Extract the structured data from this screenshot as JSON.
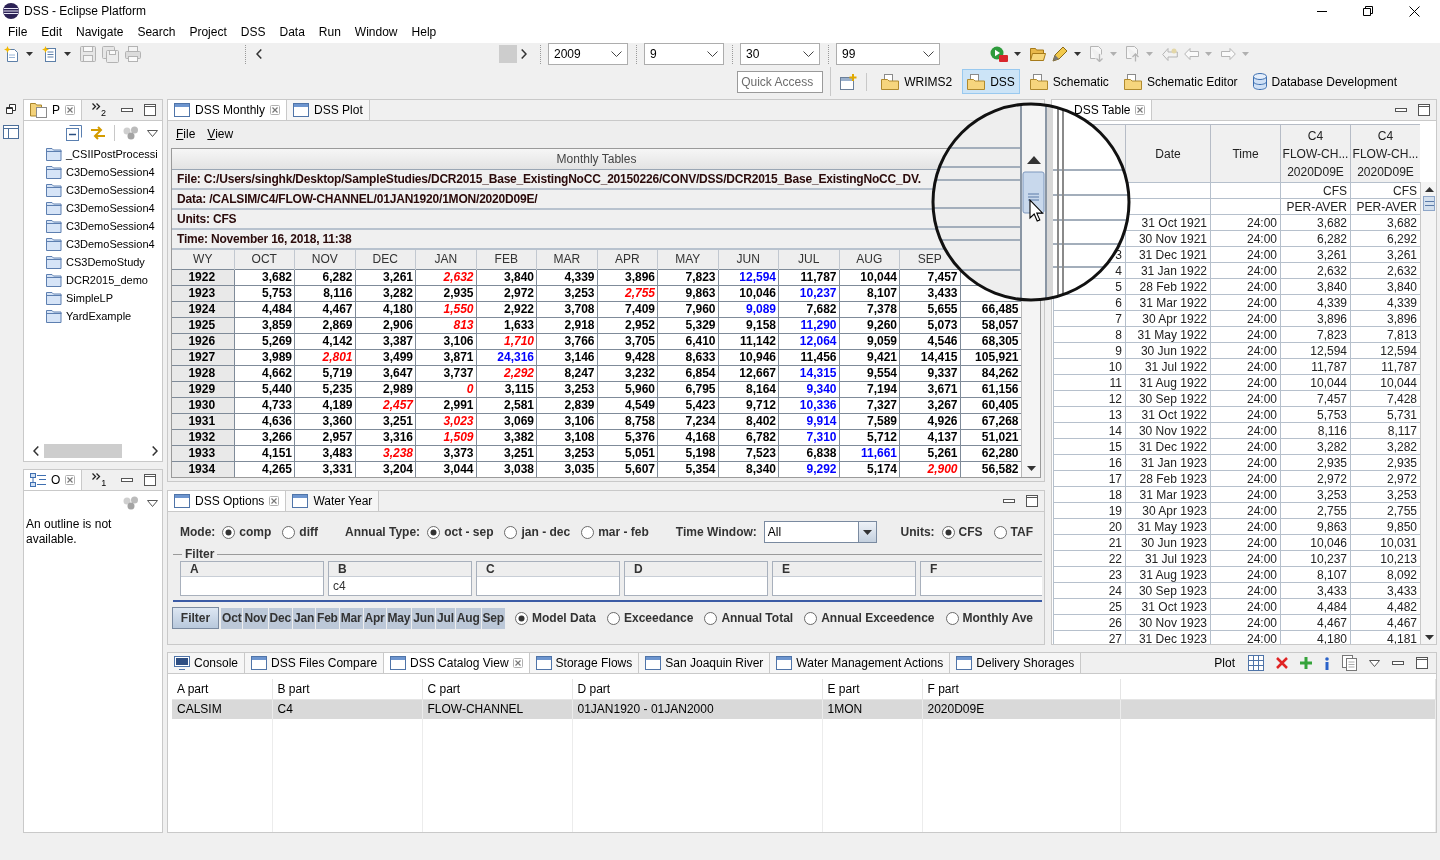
{
  "window": {
    "title": "DSS - Eclipse Platform"
  },
  "menu": [
    "File",
    "Edit",
    "Navigate",
    "Search",
    "Project",
    "DSS",
    "Data",
    "Run",
    "Window",
    "Help"
  ],
  "toolbar": {
    "combos": [
      "2009",
      "9",
      "30",
      "99"
    ]
  },
  "quick_access": {
    "placeholder": "Quick Access"
  },
  "perspectives": [
    {
      "label": "WRIMS2",
      "kind": "folder",
      "selected": false
    },
    {
      "label": "DSS",
      "kind": "folder",
      "selected": true
    },
    {
      "label": "Schematic",
      "kind": "folder",
      "selected": false
    },
    {
      "label": "Schematic Editor",
      "kind": "folder",
      "selected": false
    },
    {
      "label": "Database Development",
      "kind": "database",
      "selected": false
    }
  ],
  "project_explorer": {
    "tab": {
      "label": "P",
      "selected": true
    },
    "overflow_count": "2",
    "items": [
      "_CSIIPostProcessi",
      "C3DemoSession4",
      "C3DemoSession4",
      "C3DemoSession4",
      "C3DemoSession4",
      "C3DemoSession4",
      "CS3DemoStudy",
      "DCR2015_demo",
      "SimpleLP",
      "YardExample"
    ]
  },
  "outline": {
    "tab": {
      "label": "O",
      "selected": true
    },
    "overflow_count": "1",
    "message": "An outline is not available."
  },
  "monthly": {
    "tabs": [
      {
        "label": "DSS Monthly",
        "selected": true
      },
      {
        "label": "DSS Plot",
        "selected": false
      }
    ],
    "menu": [
      "File",
      "View"
    ],
    "title": "Monthly Tables",
    "info": [
      "File: C:/Users/singhk/Desktop/SampleStudies/DCR2015_Base_ExistingNoCC_20150226/CONV/DSS/DCR2015_Base_ExistingNoCC_DV.",
      "Data: /CALSIM/C4/FLOW-CHANNEL/01JAN1920/1MON/2020D09E/",
      "Units: CFS",
      "Time: November 16, 2018, 11:38"
    ],
    "corner": "WY",
    "columns": [
      "OCT",
      "NOV",
      "DEC",
      "JAN",
      "FEB",
      "MAR",
      "APR",
      "MAY",
      "JUN",
      "JUL",
      "AUG",
      "SEP"
    ],
    "rows": [
      {
        "wy": "1922",
        "cells": [
          {
            "value": "3,682",
            "kind": "plain"
          },
          {
            "value": "6,282",
            "kind": "plain"
          },
          {
            "value": "3,261",
            "kind": "plain"
          },
          {
            "value": "2,632",
            "kind": "low"
          },
          {
            "value": "3,840",
            "kind": "plain"
          },
          {
            "value": "4,339",
            "kind": "plain"
          },
          {
            "value": "3,896",
            "kind": "plain"
          },
          {
            "value": "7,823",
            "kind": "plain"
          },
          {
            "value": "12,594",
            "kind": "high"
          },
          {
            "value": "11,787",
            "kind": "plain"
          },
          {
            "value": "10,044",
            "kind": "plain"
          },
          {
            "value": "7,457",
            "kind": "plain"
          }
        ]
      },
      {
        "wy": "1923",
        "cells": [
          {
            "value": "5,753",
            "kind": "plain"
          },
          {
            "value": "8,116",
            "kind": "plain"
          },
          {
            "value": "3,282",
            "kind": "plain"
          },
          {
            "value": "2,935",
            "kind": "plain"
          },
          {
            "value": "2,972",
            "kind": "plain"
          },
          {
            "value": "3,253",
            "kind": "plain"
          },
          {
            "value": "2,755",
            "kind": "low"
          },
          {
            "value": "9,863",
            "kind": "plain"
          },
          {
            "value": "10,046",
            "kind": "plain"
          },
          {
            "value": "10,237",
            "kind": "high"
          },
          {
            "value": "8,107",
            "kind": "plain"
          },
          {
            "value": "3,433",
            "kind": "plain"
          }
        ]
      },
      {
        "wy": "1924",
        "cells": [
          {
            "value": "4,484",
            "kind": "plain"
          },
          {
            "value": "4,467",
            "kind": "plain"
          },
          {
            "value": "4,180",
            "kind": "plain"
          },
          {
            "value": "1,550",
            "kind": "low"
          },
          {
            "value": "2,922",
            "kind": "plain"
          },
          {
            "value": "3,708",
            "kind": "plain"
          },
          {
            "value": "7,409",
            "kind": "plain"
          },
          {
            "value": "7,960",
            "kind": "plain"
          },
          {
            "value": "9,089",
            "kind": "high"
          },
          {
            "value": "7,682",
            "kind": "plain"
          },
          {
            "value": "7,378",
            "kind": "plain"
          },
          {
            "value": "5,655",
            "kind": "plain"
          },
          {
            "value": "66,485",
            "kind": "plain"
          }
        ]
      },
      {
        "wy": "1925",
        "cells": [
          {
            "value": "3,859",
            "kind": "plain"
          },
          {
            "value": "2,869",
            "kind": "plain"
          },
          {
            "value": "2,906",
            "kind": "plain"
          },
          {
            "value": "813",
            "kind": "low"
          },
          {
            "value": "1,633",
            "kind": "plain"
          },
          {
            "value": "2,918",
            "kind": "plain"
          },
          {
            "value": "2,952",
            "kind": "plain"
          },
          {
            "value": "5,329",
            "kind": "plain"
          },
          {
            "value": "9,158",
            "kind": "plain"
          },
          {
            "value": "11,290",
            "kind": "high"
          },
          {
            "value": "9,260",
            "kind": "plain"
          },
          {
            "value": "5,073",
            "kind": "plain"
          },
          {
            "value": "58,057",
            "kind": "plain"
          }
        ]
      },
      {
        "wy": "1926",
        "cells": [
          {
            "value": "5,269",
            "kind": "plain"
          },
          {
            "value": "4,142",
            "kind": "plain"
          },
          {
            "value": "3,387",
            "kind": "plain"
          },
          {
            "value": "3,106",
            "kind": "plain"
          },
          {
            "value": "1,710",
            "kind": "low"
          },
          {
            "value": "3,766",
            "kind": "plain"
          },
          {
            "value": "3,705",
            "kind": "plain"
          },
          {
            "value": "6,410",
            "kind": "plain"
          },
          {
            "value": "11,142",
            "kind": "plain"
          },
          {
            "value": "12,064",
            "kind": "high"
          },
          {
            "value": "9,059",
            "kind": "plain"
          },
          {
            "value": "4,546",
            "kind": "plain"
          },
          {
            "value": "68,305",
            "kind": "plain"
          }
        ]
      },
      {
        "wy": "1927",
        "cells": [
          {
            "value": "3,989",
            "kind": "plain"
          },
          {
            "value": "2,801",
            "kind": "low"
          },
          {
            "value": "3,499",
            "kind": "plain"
          },
          {
            "value": "3,871",
            "kind": "plain"
          },
          {
            "value": "24,316",
            "kind": "high"
          },
          {
            "value": "3,146",
            "kind": "plain"
          },
          {
            "value": "9,428",
            "kind": "plain"
          },
          {
            "value": "8,633",
            "kind": "plain"
          },
          {
            "value": "10,946",
            "kind": "plain"
          },
          {
            "value": "11,456",
            "kind": "plain"
          },
          {
            "value": "9,421",
            "kind": "plain"
          },
          {
            "value": "14,415",
            "kind": "plain"
          },
          {
            "value": "105,921",
            "kind": "plain"
          }
        ]
      },
      {
        "wy": "1928",
        "cells": [
          {
            "value": "4,662",
            "kind": "plain"
          },
          {
            "value": "5,719",
            "kind": "plain"
          },
          {
            "value": "3,647",
            "kind": "plain"
          },
          {
            "value": "3,737",
            "kind": "plain"
          },
          {
            "value": "2,292",
            "kind": "low"
          },
          {
            "value": "8,247",
            "kind": "plain"
          },
          {
            "value": "3,232",
            "kind": "plain"
          },
          {
            "value": "6,854",
            "kind": "plain"
          },
          {
            "value": "12,667",
            "kind": "plain"
          },
          {
            "value": "14,315",
            "kind": "high"
          },
          {
            "value": "9,554",
            "kind": "plain"
          },
          {
            "value": "9,337",
            "kind": "plain"
          },
          {
            "value": "84,262",
            "kind": "plain"
          }
        ]
      },
      {
        "wy": "1929",
        "cells": [
          {
            "value": "5,440",
            "kind": "plain"
          },
          {
            "value": "5,235",
            "kind": "plain"
          },
          {
            "value": "2,989",
            "kind": "plain"
          },
          {
            "value": "0",
            "kind": "low"
          },
          {
            "value": "3,115",
            "kind": "plain"
          },
          {
            "value": "3,253",
            "kind": "plain"
          },
          {
            "value": "5,960",
            "kind": "plain"
          },
          {
            "value": "6,795",
            "kind": "plain"
          },
          {
            "value": "8,164",
            "kind": "plain"
          },
          {
            "value": "9,340",
            "kind": "high"
          },
          {
            "value": "7,194",
            "kind": "plain"
          },
          {
            "value": "3,671",
            "kind": "plain"
          },
          {
            "value": "61,156",
            "kind": "plain"
          }
        ]
      },
      {
        "wy": "1930",
        "cells": [
          {
            "value": "4,733",
            "kind": "plain"
          },
          {
            "value": "4,189",
            "kind": "plain"
          },
          {
            "value": "2,457",
            "kind": "low"
          },
          {
            "value": "2,991",
            "kind": "plain"
          },
          {
            "value": "2,581",
            "kind": "plain"
          },
          {
            "value": "2,839",
            "kind": "plain"
          },
          {
            "value": "4,549",
            "kind": "plain"
          },
          {
            "value": "5,423",
            "kind": "plain"
          },
          {
            "value": "9,712",
            "kind": "plain"
          },
          {
            "value": "10,336",
            "kind": "high"
          },
          {
            "value": "7,327",
            "kind": "plain"
          },
          {
            "value": "3,267",
            "kind": "plain"
          },
          {
            "value": "60,405",
            "kind": "plain"
          }
        ]
      },
      {
        "wy": "1931",
        "cells": [
          {
            "value": "4,636",
            "kind": "plain"
          },
          {
            "value": "3,360",
            "kind": "plain"
          },
          {
            "value": "3,251",
            "kind": "plain"
          },
          {
            "value": "3,023",
            "kind": "low"
          },
          {
            "value": "3,069",
            "kind": "plain"
          },
          {
            "value": "3,106",
            "kind": "plain"
          },
          {
            "value": "8,758",
            "kind": "plain"
          },
          {
            "value": "7,234",
            "kind": "plain"
          },
          {
            "value": "8,402",
            "kind": "plain"
          },
          {
            "value": "9,914",
            "kind": "high"
          },
          {
            "value": "7,589",
            "kind": "plain"
          },
          {
            "value": "4,926",
            "kind": "plain"
          },
          {
            "value": "67,268",
            "kind": "plain"
          }
        ]
      },
      {
        "wy": "1932",
        "cells": [
          {
            "value": "3,266",
            "kind": "plain"
          },
          {
            "value": "2,957",
            "kind": "plain"
          },
          {
            "value": "3,316",
            "kind": "plain"
          },
          {
            "value": "1,509",
            "kind": "low"
          },
          {
            "value": "3,382",
            "kind": "plain"
          },
          {
            "value": "3,108",
            "kind": "plain"
          },
          {
            "value": "5,376",
            "kind": "plain"
          },
          {
            "value": "4,168",
            "kind": "plain"
          },
          {
            "value": "6,782",
            "kind": "plain"
          },
          {
            "value": "7,310",
            "kind": "high"
          },
          {
            "value": "5,712",
            "kind": "plain"
          },
          {
            "value": "4,137",
            "kind": "plain"
          },
          {
            "value": "51,021",
            "kind": "plain"
          }
        ]
      },
      {
        "wy": "1933",
        "cells": [
          {
            "value": "4,151",
            "kind": "plain"
          },
          {
            "value": "3,483",
            "kind": "plain"
          },
          {
            "value": "3,238",
            "kind": "low"
          },
          {
            "value": "3,373",
            "kind": "plain"
          },
          {
            "value": "3,251",
            "kind": "plain"
          },
          {
            "value": "3,253",
            "kind": "plain"
          },
          {
            "value": "5,051",
            "kind": "plain"
          },
          {
            "value": "5,198",
            "kind": "plain"
          },
          {
            "value": "7,523",
            "kind": "plain"
          },
          {
            "value": "6,838",
            "kind": "plain"
          },
          {
            "value": "11,661",
            "kind": "high"
          },
          {
            "value": "5,261",
            "kind": "plain"
          },
          {
            "value": "62,280",
            "kind": "plain"
          }
        ]
      },
      {
        "wy": "1934",
        "cells": [
          {
            "value": "4,265",
            "kind": "plain"
          },
          {
            "value": "3,331",
            "kind": "plain"
          },
          {
            "value": "3,204",
            "kind": "plain"
          },
          {
            "value": "3,044",
            "kind": "plain"
          },
          {
            "value": "3,038",
            "kind": "plain"
          },
          {
            "value": "3,035",
            "kind": "plain"
          },
          {
            "value": "5,607",
            "kind": "plain"
          },
          {
            "value": "5,354",
            "kind": "plain"
          },
          {
            "value": "8,340",
            "kind": "plain"
          },
          {
            "value": "9,292",
            "kind": "high"
          },
          {
            "value": "5,174",
            "kind": "plain"
          },
          {
            "value": "2,900",
            "kind": "low"
          },
          {
            "value": "56,582",
            "kind": "plain"
          }
        ]
      }
    ]
  },
  "options": {
    "tabs": [
      {
        "label": "DSS Options",
        "selected": true
      },
      {
        "label": "Water Year",
        "selected": false
      }
    ],
    "mode": {
      "label": "Mode:",
      "choices": [
        {
          "label": "comp",
          "selected": true
        },
        {
          "label": "diff",
          "selected": false
        }
      ]
    },
    "annual_type": {
      "label": "Annual Type:",
      "choices": [
        {
          "label": "oct - sep",
          "selected": true
        },
        {
          "label": "jan - dec",
          "selected": false
        },
        {
          "label": "mar - feb",
          "selected": false
        }
      ]
    },
    "time_window": {
      "label": "Time Window:",
      "value": "All"
    },
    "units": {
      "label": "Units:",
      "choices": [
        {
          "label": "CFS",
          "selected": true
        },
        {
          "label": "TAF",
          "selected": false
        }
      ]
    },
    "filter": {
      "title": "Filter",
      "fields": [
        {
          "label": "A"
        },
        {
          "label": "B",
          "value": "c4"
        },
        {
          "label": "C"
        },
        {
          "label": "D"
        },
        {
          "label": "E"
        },
        {
          "label": "F"
        }
      ]
    },
    "filter_button": "Filter",
    "months": [
      {
        "label": "Oct",
        "selected": true
      },
      {
        "label": "Nov",
        "selected": true
      },
      {
        "label": "Dec",
        "selected": true
      },
      {
        "label": "Jan",
        "selected": true
      },
      {
        "label": "Feb",
        "selected": true
      },
      {
        "label": "Mar",
        "selected": true
      },
      {
        "label": "Apr",
        "selected": true
      },
      {
        "label": "May",
        "selected": true
      },
      {
        "label": "Jun",
        "selected": true
      },
      {
        "label": "Jul",
        "selected": true
      },
      {
        "label": "Aug",
        "selected": true
      },
      {
        "label": "Sep",
        "selected": true
      }
    ],
    "display": [
      {
        "label": "Model Data",
        "selected": true
      },
      {
        "label": "Exceedance",
        "selected": false
      },
      {
        "label": "Annual Total",
        "selected": false
      },
      {
        "label": "Annual Exceedence",
        "selected": false
      },
      {
        "label": "Monthly Ave",
        "selected": false
      }
    ]
  },
  "dss_table": {
    "tab": {
      "label": "DSS Table",
      "selected": true
    },
    "columns": [
      [
        "Date"
      ],
      [
        "Time"
      ],
      [
        "C4",
        "FLOW-CH...",
        "2020D09E"
      ],
      [
        "C4",
        "FLOW-CH...",
        "2020D09E"
      ]
    ],
    "units": [
      "CFS",
      "CFS"
    ],
    "types": [
      "PER-AVER",
      "PER-AVER"
    ],
    "rows": [
      {
        "date": "31 Oct 1921",
        "time": "24:00",
        "values": [
          "3,682",
          "3,682"
        ]
      },
      {
        "date": "30 Nov 1921",
        "time": "24:00",
        "values": [
          "6,282",
          "6,292"
        ]
      },
      {
        "index": "3",
        "date": "31 Dec 1921",
        "time": "24:00",
        "values": [
          "3,261",
          "3,261"
        ]
      },
      {
        "index": "4",
        "date": "31 Jan 1922",
        "time": "24:00",
        "values": [
          "2,632",
          "2,632"
        ]
      },
      {
        "index": "5",
        "date": "28 Feb 1922",
        "time": "24:00",
        "values": [
          "3,840",
          "3,840"
        ]
      },
      {
        "index": "6",
        "date": "31 Mar 1922",
        "time": "24:00",
        "values": [
          "4,339",
          "4,339"
        ]
      },
      {
        "index": "7",
        "date": "30 Apr 1922",
        "time": "24:00",
        "values": [
          "3,896",
          "3,896"
        ]
      },
      {
        "index": "8",
        "date": "31 May 1922",
        "time": "24:00",
        "values": [
          "7,823",
          "7,813"
        ]
      },
      {
        "index": "9",
        "date": "30 Jun 1922",
        "time": "24:00",
        "values": [
          "12,594",
          "12,594"
        ]
      },
      {
        "index": "10",
        "date": "31 Jul 1922",
        "time": "24:00",
        "values": [
          "11,787",
          "11,787"
        ]
      },
      {
        "index": "11",
        "date": "31 Aug 1922",
        "time": "24:00",
        "values": [
          "10,044",
          "10,044"
        ]
      },
      {
        "index": "12",
        "date": "30 Sep 1922",
        "time": "24:00",
        "values": [
          "7,457",
          "7,428"
        ]
      },
      {
        "index": "13",
        "date": "31 Oct 1922",
        "time": "24:00",
        "values": [
          "5,753",
          "5,731"
        ]
      },
      {
        "index": "14",
        "date": "30 Nov 1922",
        "time": "24:00",
        "values": [
          "8,116",
          "8,117"
        ]
      },
      {
        "index": "15",
        "date": "31 Dec 1922",
        "time": "24:00",
        "values": [
          "3,282",
          "3,282"
        ]
      },
      {
        "index": "16",
        "date": "31 Jan 1923",
        "time": "24:00",
        "values": [
          "2,935",
          "2,935"
        ]
      },
      {
        "index": "17",
        "date": "28 Feb 1923",
        "time": "24:00",
        "values": [
          "2,972",
          "2,972"
        ]
      },
      {
        "index": "18",
        "date": "31 Mar 1923",
        "time": "24:00",
        "values": [
          "3,253",
          "3,253"
        ]
      },
      {
        "index": "19",
        "date": "30 Apr 1923",
        "time": "24:00",
        "values": [
          "2,755",
          "2,755"
        ]
      },
      {
        "index": "20",
        "date": "31 May 1923",
        "time": "24:00",
        "values": [
          "9,863",
          "9,850"
        ]
      },
      {
        "index": "21",
        "date": "30 Jun 1923",
        "time": "24:00",
        "values": [
          "10,046",
          "10,031"
        ]
      },
      {
        "index": "22",
        "date": "31 Jul 1923",
        "time": "24:00",
        "values": [
          "10,237",
          "10,213"
        ]
      },
      {
        "index": "23",
        "date": "31 Aug 1923",
        "time": "24:00",
        "values": [
          "8,107",
          "8,092"
        ]
      },
      {
        "index": "24",
        "date": "30 Sep 1923",
        "time": "24:00",
        "values": [
          "3,433",
          "3,433"
        ]
      },
      {
        "index": "25",
        "date": "31 Oct 1923",
        "time": "24:00",
        "values": [
          "4,484",
          "4,482"
        ]
      },
      {
        "index": "26",
        "date": "30 Nov 1923",
        "time": "24:00",
        "values": [
          "4,467",
          "4,467"
        ]
      },
      {
        "index": "27",
        "date": "31 Dec 1923",
        "time": "24:00",
        "values": [
          "4,180",
          "4,181"
        ]
      }
    ]
  },
  "bottom": {
    "tabs": [
      {
        "label": "Console",
        "kind": "console",
        "selected": false
      },
      {
        "label": "DSS Files Compare",
        "kind": "view",
        "selected": false
      },
      {
        "label": "DSS Catalog View",
        "kind": "view",
        "selected": true
      },
      {
        "label": "Storage Flows",
        "kind": "view",
        "selected": false
      },
      {
        "label": "San Joaquin River",
        "kind": "view",
        "selected": false
      },
      {
        "label": "Water Management Actions",
        "kind": "view",
        "selected": false
      },
      {
        "label": "Delivery Shorages",
        "kind": "view",
        "selected": false
      }
    ],
    "toolbar_label": "Plot",
    "catalog": {
      "columns": [
        "A part",
        "B part",
        "C part",
        "D part",
        "E part",
        "F part"
      ],
      "rows": [
        {
          "cells": [
            "CALSIM",
            "C4",
            "FLOW-CHANNEL",
            "01JAN1920 - 01JAN2000",
            "1MON",
            "2020D09E"
          ],
          "selected": true
        }
      ]
    }
  }
}
